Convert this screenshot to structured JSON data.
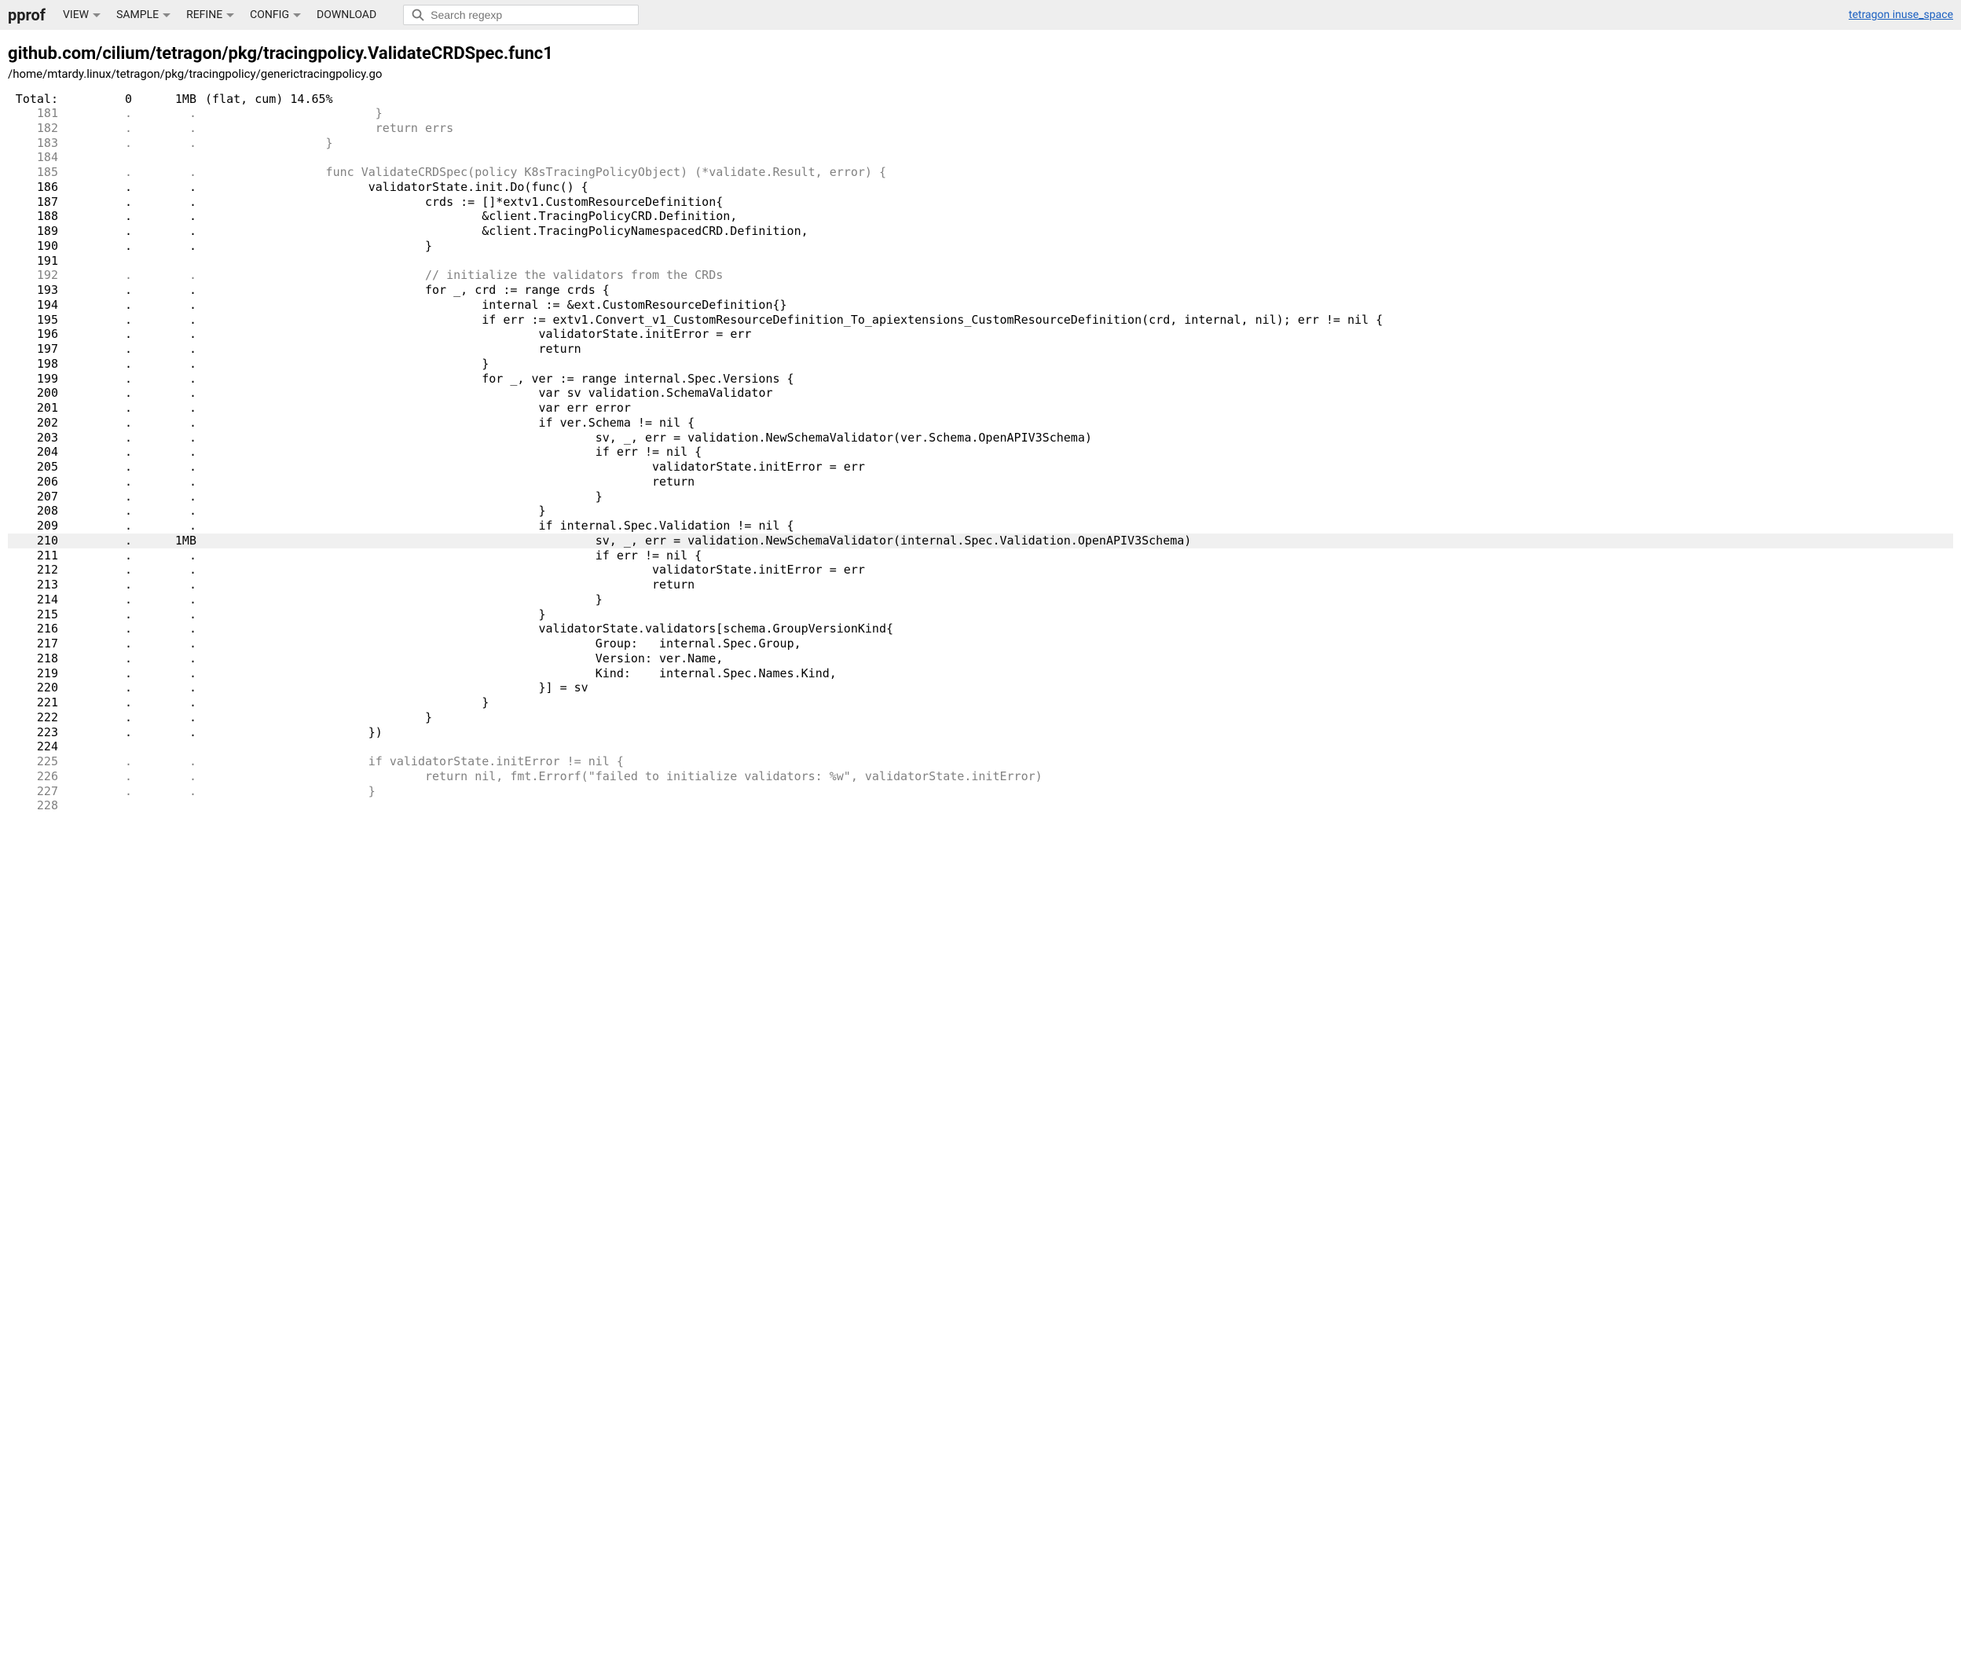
{
  "header": {
    "logo": "pprof",
    "menu": {
      "view": "VIEW",
      "sample": "SAMPLE",
      "refine": "REFINE",
      "config": "CONFIG",
      "download": "DOWNLOAD"
    },
    "search": {
      "placeholder": "Search regexp"
    },
    "right_link": "tetragon inuse_space"
  },
  "page": {
    "title": "github.com/cilium/tetragon/pkg/tracingpolicy.ValidateCRDSpec.func1",
    "subtitle": "/home/mtardy.linux/tetragon/pkg/tracingpolicy/generictracingpolicy.go"
  },
  "total": {
    "label": " Total:",
    "flat": "0",
    "cum": "1MB",
    "suffix": " (flat, cum) 14.65%"
  },
  "lines": [
    {
      "n": "181",
      "f": ".",
      "c": ".",
      "code": "                         } ",
      "live": false,
      "hl": false
    },
    {
      "n": "182",
      "f": ".",
      "c": ".",
      "code": "                         return errs ",
      "live": false,
      "hl": false
    },
    {
      "n": "183",
      "f": ".",
      "c": ".",
      "code": "                  } ",
      "live": false,
      "hl": false
    },
    {
      "n": "184",
      "f": "",
      "c": "",
      "code": "                   ",
      "live": false,
      "hl": false
    },
    {
      "n": "185",
      "f": ".",
      "c": ".",
      "code": "                  func ValidateCRDSpec(policy K8sTracingPolicyObject) (*validate.Result, error) { ",
      "live": false,
      "hl": false
    },
    {
      "n": "186",
      "f": ".",
      "c": ".",
      "code": "                  \tvalidatorState.init.Do(func() { ",
      "live": true,
      "hl": false
    },
    {
      "n": "187",
      "f": ".",
      "c": ".",
      "code": "                  \t\tcrds := []*extv1.CustomResourceDefinition{ ",
      "live": true,
      "hl": false
    },
    {
      "n": "188",
      "f": ".",
      "c": ".",
      "code": "                  \t\t\t&client.TracingPolicyCRD.Definition, ",
      "live": true,
      "hl": false
    },
    {
      "n": "189",
      "f": ".",
      "c": ".",
      "code": "                  \t\t\t&client.TracingPolicyNamespacedCRD.Definition, ",
      "live": true,
      "hl": false
    },
    {
      "n": "190",
      "f": ".",
      "c": ".",
      "code": "                  \t\t} ",
      "live": true,
      "hl": false
    },
    {
      "n": "191",
      "f": "",
      "c": "",
      "code": "                   ",
      "live": true,
      "hl": false
    },
    {
      "n": "192",
      "f": ".",
      "c": ".",
      "code": "                  \t\t// initialize the validators from the CRDs ",
      "live": false,
      "hl": false
    },
    {
      "n": "193",
      "f": ".",
      "c": ".",
      "code": "                  \t\tfor _, crd := range crds { ",
      "live": true,
      "hl": false
    },
    {
      "n": "194",
      "f": ".",
      "c": ".",
      "code": "                  \t\t\tinternal := &ext.CustomResourceDefinition{} ",
      "live": true,
      "hl": false
    },
    {
      "n": "195",
      "f": ".",
      "c": ".",
      "code": "                  \t\t\tif err := extv1.Convert_v1_CustomResourceDefinition_To_apiextensions_CustomResourceDefinition(crd, internal, nil); err != nil { ",
      "live": true,
      "hl": false
    },
    {
      "n": "196",
      "f": ".",
      "c": ".",
      "code": "                  \t\t\t\tvalidatorState.initError = err ",
      "live": true,
      "hl": false
    },
    {
      "n": "197",
      "f": ".",
      "c": ".",
      "code": "                  \t\t\t\treturn ",
      "live": true,
      "hl": false
    },
    {
      "n": "198",
      "f": ".",
      "c": ".",
      "code": "                  \t\t\t} ",
      "live": true,
      "hl": false
    },
    {
      "n": "199",
      "f": ".",
      "c": ".",
      "code": "                  \t\t\tfor _, ver := range internal.Spec.Versions { ",
      "live": true,
      "hl": false
    },
    {
      "n": "200",
      "f": ".",
      "c": ".",
      "code": "                  \t\t\t\tvar sv validation.SchemaValidator ",
      "live": true,
      "hl": false
    },
    {
      "n": "201",
      "f": ".",
      "c": ".",
      "code": "                  \t\t\t\tvar err error ",
      "live": true,
      "hl": false
    },
    {
      "n": "202",
      "f": ".",
      "c": ".",
      "code": "                  \t\t\t\tif ver.Schema != nil { ",
      "live": true,
      "hl": false
    },
    {
      "n": "203",
      "f": ".",
      "c": ".",
      "code": "                  \t\t\t\t\tsv, _, err = validation.NewSchemaValidator(ver.Schema.OpenAPIV3Schema) ",
      "live": true,
      "hl": false
    },
    {
      "n": "204",
      "f": ".",
      "c": ".",
      "code": "                  \t\t\t\t\tif err != nil { ",
      "live": true,
      "hl": false
    },
    {
      "n": "205",
      "f": ".",
      "c": ".",
      "code": "                  \t\t\t\t\t\tvalidatorState.initError = err ",
      "live": true,
      "hl": false
    },
    {
      "n": "206",
      "f": ".",
      "c": ".",
      "code": "                  \t\t\t\t\t\treturn ",
      "live": true,
      "hl": false
    },
    {
      "n": "207",
      "f": ".",
      "c": ".",
      "code": "                  \t\t\t\t\t} ",
      "live": true,
      "hl": false
    },
    {
      "n": "208",
      "f": ".",
      "c": ".",
      "code": "                  \t\t\t\t} ",
      "live": true,
      "hl": false
    },
    {
      "n": "209",
      "f": ".",
      "c": ".",
      "code": "                  \t\t\t\tif internal.Spec.Validation != nil { ",
      "live": true,
      "hl": false
    },
    {
      "n": "210",
      "f": ".",
      "c": "1MB",
      "code": "                  \t\t\t\t\tsv, _, err = validation.NewSchemaValidator(internal.Spec.Validation.OpenAPIV3Schema) ",
      "live": true,
      "hl": true
    },
    {
      "n": "211",
      "f": ".",
      "c": ".",
      "code": "                  \t\t\t\t\tif err != nil { ",
      "live": true,
      "hl": false
    },
    {
      "n": "212",
      "f": ".",
      "c": ".",
      "code": "                  \t\t\t\t\t\tvalidatorState.initError = err ",
      "live": true,
      "hl": false
    },
    {
      "n": "213",
      "f": ".",
      "c": ".",
      "code": "                  \t\t\t\t\t\treturn ",
      "live": true,
      "hl": false
    },
    {
      "n": "214",
      "f": ".",
      "c": ".",
      "code": "                  \t\t\t\t\t} ",
      "live": true,
      "hl": false
    },
    {
      "n": "215",
      "f": ".",
      "c": ".",
      "code": "                  \t\t\t\t} ",
      "live": true,
      "hl": false
    },
    {
      "n": "216",
      "f": ".",
      "c": ".",
      "code": "                  \t\t\t\tvalidatorState.validators[schema.GroupVersionKind{ ",
      "live": true,
      "hl": false
    },
    {
      "n": "217",
      "f": ".",
      "c": ".",
      "code": "                  \t\t\t\t\tGroup:   internal.Spec.Group, ",
      "live": true,
      "hl": false
    },
    {
      "n": "218",
      "f": ".",
      "c": ".",
      "code": "                  \t\t\t\t\tVersion: ver.Name, ",
      "live": true,
      "hl": false
    },
    {
      "n": "219",
      "f": ".",
      "c": ".",
      "code": "                  \t\t\t\t\tKind:    internal.Spec.Names.Kind, ",
      "live": true,
      "hl": false
    },
    {
      "n": "220",
      "f": ".",
      "c": ".",
      "code": "                  \t\t\t\t}] = sv ",
      "live": true,
      "hl": false
    },
    {
      "n": "221",
      "f": ".",
      "c": ".",
      "code": "                  \t\t\t} ",
      "live": true,
      "hl": false
    },
    {
      "n": "222",
      "f": ".",
      "c": ".",
      "code": "                  \t\t} ",
      "live": true,
      "hl": false
    },
    {
      "n": "223",
      "f": ".",
      "c": ".",
      "code": "                  \t}) ",
      "live": true,
      "hl": false
    },
    {
      "n": "224",
      "f": "",
      "c": "",
      "code": "                   ",
      "live": true,
      "hl": false
    },
    {
      "n": "225",
      "f": ".",
      "c": ".",
      "code": "                  \tif validatorState.initError != nil { ",
      "live": false,
      "hl": false
    },
    {
      "n": "226",
      "f": ".",
      "c": ".",
      "code": "                  \t\treturn nil, fmt.Errorf(\"failed to initialize validators: %w\", validatorState.initError) ",
      "live": false,
      "hl": false
    },
    {
      "n": "227",
      "f": ".",
      "c": ".",
      "code": "                  \t} ",
      "live": false,
      "hl": false
    },
    {
      "n": "228",
      "f": "",
      "c": "",
      "code": "                   ",
      "live": false,
      "hl": false
    }
  ]
}
